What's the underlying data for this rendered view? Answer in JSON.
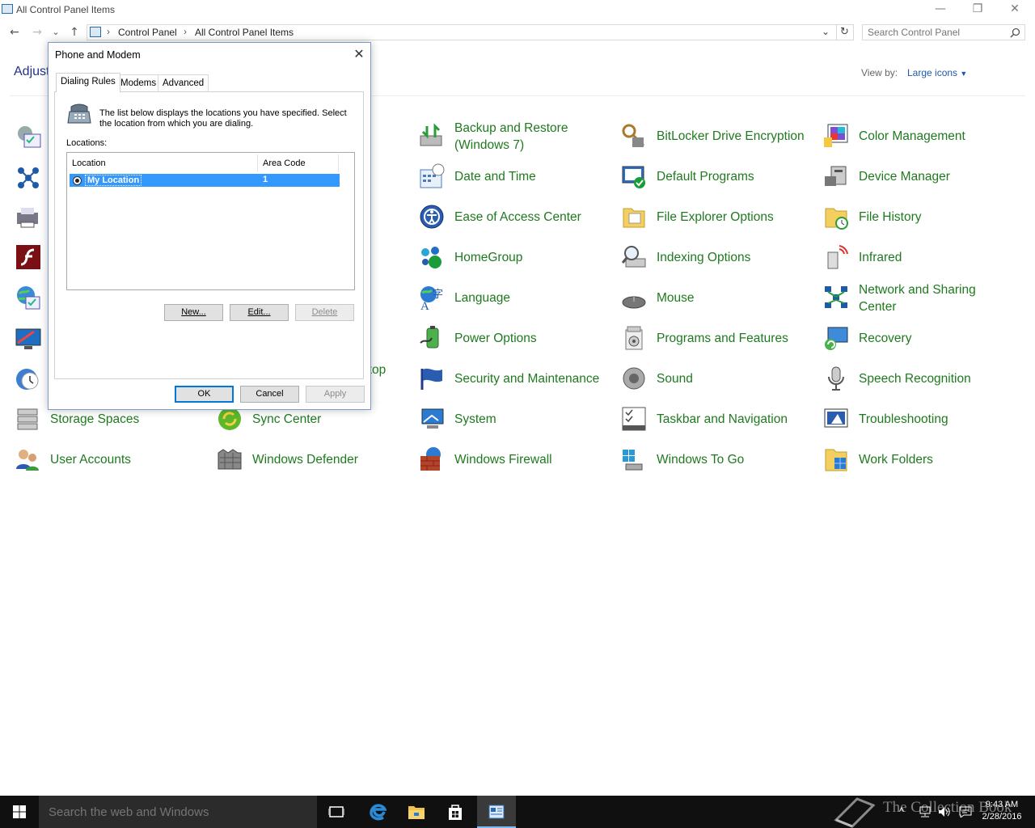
{
  "window": {
    "title": "All Control Panel Items",
    "minimize": "—",
    "restore": "❐",
    "close": "✕"
  },
  "nav": {
    "back": "←",
    "forward": "→",
    "recent": "⌄",
    "up": "↑",
    "refresh": "↻",
    "dropdown": "⌄"
  },
  "breadcrumb": [
    "Control Panel",
    "All Control Panel Items"
  ],
  "search": {
    "placeholder": "Search Control Panel"
  },
  "heading": "Adjust",
  "view": {
    "label": "View by:",
    "value": "Large icons"
  },
  "partial_hidden_text": "ktop",
  "items": [
    {
      "label": "Backup and Restore (Windows 7)",
      "icon": "backup-icon"
    },
    {
      "label": "BitLocker Drive Encryption",
      "icon": "bitlocker-icon"
    },
    {
      "label": "Color Management",
      "icon": "color-management-icon"
    },
    {
      "label": "Date and Time",
      "icon": "calendar-clock-icon"
    },
    {
      "label": "Default Programs",
      "icon": "default-programs-icon"
    },
    {
      "label": "Device Manager",
      "icon": "device-manager-icon"
    },
    {
      "label": "Ease of Access Center",
      "icon": "ease-of-access-icon"
    },
    {
      "label": "File Explorer Options",
      "icon": "folder-options-icon"
    },
    {
      "label": "File History",
      "icon": "file-history-icon"
    },
    {
      "label": "HomeGroup",
      "icon": "homegroup-icon"
    },
    {
      "label": "Indexing Options",
      "icon": "indexing-icon"
    },
    {
      "label": "Infrared",
      "icon": "infrared-icon"
    },
    {
      "label": "Language",
      "icon": "language-icon"
    },
    {
      "label": "Mouse",
      "icon": "mouse-icon"
    },
    {
      "label": "Network and Sharing Center",
      "icon": "network-icon"
    },
    {
      "label": "Power Options",
      "icon": "power-icon"
    },
    {
      "label": "Programs and Features",
      "icon": "programs-icon"
    },
    {
      "label": "Recovery",
      "icon": "recovery-icon"
    },
    {
      "label": "Security and Maintenance",
      "icon": "flag-icon"
    },
    {
      "label": "Sound",
      "icon": "speaker-icon"
    },
    {
      "label": "Speech Recognition",
      "icon": "microphone-icon"
    },
    {
      "label": "Storage Spaces",
      "icon": "storage-icon"
    },
    {
      "label": "Sync Center",
      "icon": "sync-icon"
    },
    {
      "label": "System",
      "icon": "system-icon"
    },
    {
      "label": "Taskbar and Navigation",
      "icon": "taskbar-icon"
    },
    {
      "label": "Troubleshooting",
      "icon": "troubleshooting-icon"
    },
    {
      "label": "User Accounts",
      "icon": "users-icon"
    },
    {
      "label": "Windows Defender",
      "icon": "defender-icon"
    },
    {
      "label": "Windows Firewall",
      "icon": "firewall-icon"
    },
    {
      "label": "Windows To Go",
      "icon": "windows-to-go-icon"
    },
    {
      "label": "Work Folders",
      "icon": "work-folders-icon"
    }
  ],
  "dialog": {
    "title": "Phone and Modem",
    "close": "✕",
    "tabs": [
      "Dialing Rules",
      "Modems",
      "Advanced"
    ],
    "description": "The list below displays the locations you have specified. Select the location from which you are dialing.",
    "locations_label": "Locations:",
    "columns": [
      "Location",
      "Area Code"
    ],
    "rows": [
      {
        "location": "My Location",
        "area_code": "1"
      }
    ],
    "buttons": {
      "new": "New...",
      "edit": "Edit...",
      "delete": "Delete",
      "ok": "OK",
      "cancel": "Cancel",
      "apply": "Apply"
    }
  },
  "taskbar": {
    "search_placeholder": "Search the web and Windows",
    "time": "9:43 AM",
    "date": "2/28/2016",
    "tray_up": "^",
    "watermark": "The Collection Book"
  },
  "colors": {
    "link_green": "#1f7a1f",
    "heading_blue": "#1e3287",
    "selection": "#3399ff",
    "taskbar": "#101010"
  }
}
